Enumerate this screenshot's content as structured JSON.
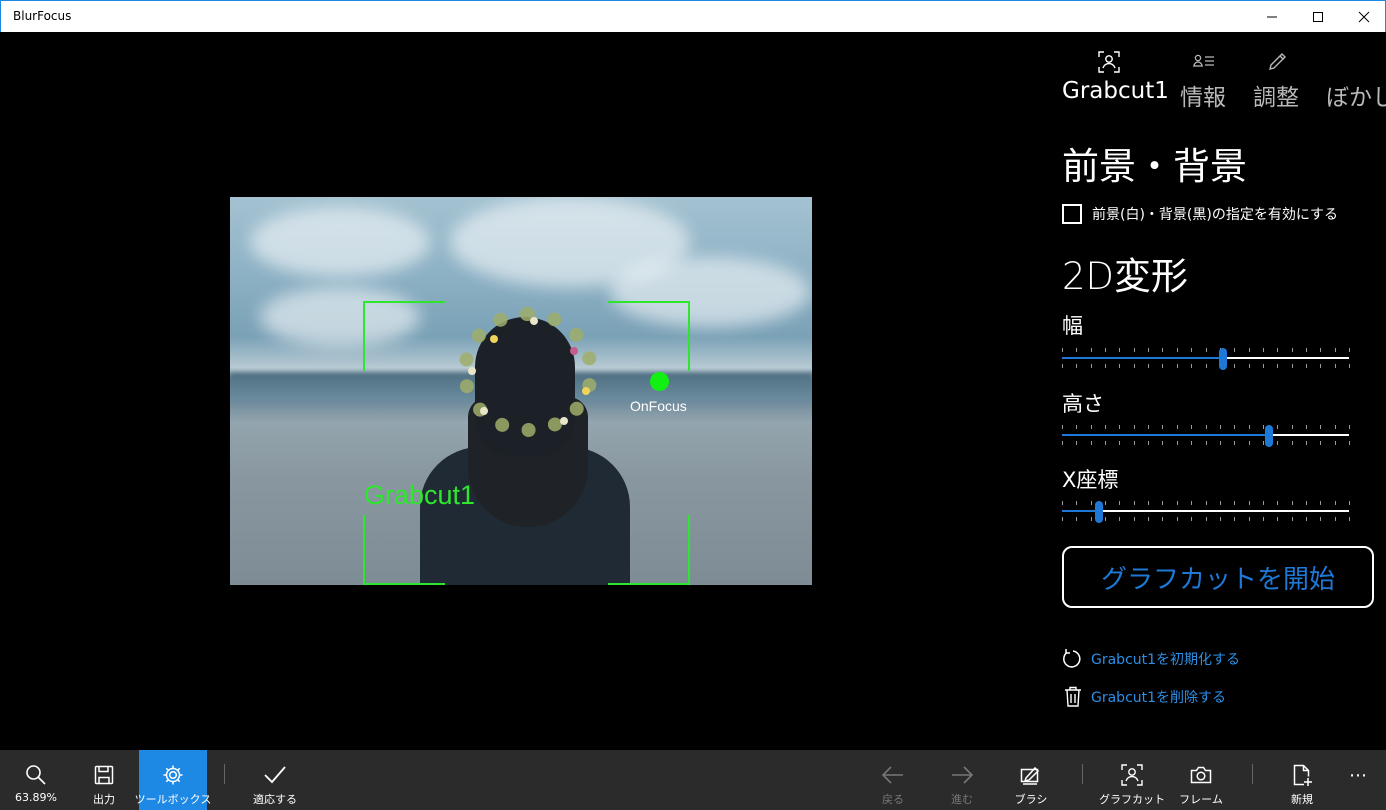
{
  "window": {
    "title": "BlurFocus"
  },
  "canvas": {
    "selection_label": "Grabcut1",
    "focus_point_label": "OnFocus",
    "accent_color": "#2ee62e"
  },
  "panel": {
    "tabs": [
      {
        "label": "Grabcut1",
        "icon": "person-frame-icon",
        "active": true
      },
      {
        "label": "情報",
        "icon": "contact-info-icon",
        "active": false
      },
      {
        "label": "調整",
        "icon": "pencil-icon",
        "active": false
      },
      {
        "label": "ぼかし",
        "icon": "blur-icon",
        "active": false
      }
    ],
    "section_fg_bg": "前景・背景",
    "checkbox_label": "前景(白)・背景(黒)の指定を有効にする",
    "checkbox_checked": false,
    "section_transform": "2D変形",
    "sliders": [
      {
        "label": "幅",
        "value": 0.56
      },
      {
        "label": "高さ",
        "value": 0.72
      },
      {
        "label": "X座標",
        "value": 0.13
      }
    ],
    "start_button": "グラフカットを開始",
    "reset_link": "Grabcut1を初期化する",
    "delete_link": "Grabcut1を削除する",
    "link_color": "#2b8fe6"
  },
  "cmdbar": {
    "zoom": "63.89%",
    "export": "出力",
    "toolbox": "ツールボックス",
    "apply": "適応する",
    "back": "戻る",
    "forward": "進む",
    "brush": "ブラシ",
    "graphcut": "グラフカット",
    "frame": "フレーム",
    "new": "新規",
    "more": "⋯",
    "active_color": "#1e88e5"
  }
}
